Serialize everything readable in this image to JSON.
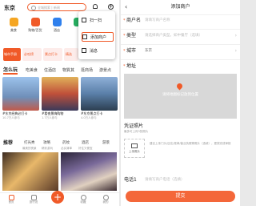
{
  "left": {
    "city": "东京",
    "search_placeholder": "全城搜索 | 新闻",
    "categories": [
      {
        "label": "美食",
        "color": "#f5a623"
      },
      {
        "label": "购物/百货",
        "color": "#f05a28"
      },
      {
        "label": "酒店",
        "color": "#2f80ed"
      },
      {
        "label": "",
        "color": "#27ae60"
      }
    ],
    "dropdown": [
      {
        "label": "扫一扫"
      },
      {
        "label": "添加商户"
      },
      {
        "label": "消息"
      }
    ],
    "promo": [
      "城市手册",
      "必吃榜",
      "景点打卡",
      "精选"
    ],
    "tabs": [
      "怎么玩",
      "吃美食",
      "住酒店",
      "物質其",
      "逛商场",
      "游景点"
    ],
    "cards": [
      {
        "title": "#东京经典必打卡",
        "sub": "10.7万人参与",
        "color": "#7ea7d6"
      },
      {
        "title": "#看夜景嗨购物",
        "sub": "1.7万人参与",
        "color": "#c0503a"
      },
      {
        "title": "#东京景点打卡",
        "sub": "4.0万人参与",
        "color": "#5a7fa8"
      }
    ],
    "tabs2": [
      {
        "label": "推荐",
        "sub": ""
      },
      {
        "label": "打光秀",
        "sub": "最美的夜景"
      },
      {
        "label": "攻略",
        "sub": "精彩游玩"
      },
      {
        "label": "药妆",
        "sub": "必买清单"
      },
      {
        "label": "酒店",
        "sub": "好住又便宜"
      },
      {
        "label": "游景",
        "sub": "热门打卡"
      }
    ],
    "nav": [
      {
        "label": "首页"
      },
      {
        "label": "旅行说"
      },
      {
        "label": "收藏"
      },
      {
        "label": "我的"
      }
    ],
    "plus_symbol": "+"
  },
  "right": {
    "title": "添加商户",
    "back_symbol": "‹",
    "fields": [
      {
        "label": "商户名",
        "placeholder": "请填写商户名称",
        "required": "*"
      },
      {
        "label": "类型",
        "placeholder": "请选择商户类型，如中餐厅（选填）",
        "required": "*"
      },
      {
        "label": "城市",
        "placeholder": "东京",
        "required": "*"
      },
      {
        "label": "地址",
        "placeholder": "",
        "required": "*"
      }
    ],
    "map_hint": "请将地图标记放到位置",
    "voucher_label": "凭证照片",
    "voucher_sub": "最多可上传3张照片",
    "upload_label": "上传照片",
    "upload_hint": "建议上传门头/店名/菜单/营业执照等照片（选填），更快完成审核",
    "phone_label": "电话1",
    "phone_placeholder": "请填写商户电话（选填）",
    "submit_label": "提交",
    "accent": "#f05a28"
  }
}
